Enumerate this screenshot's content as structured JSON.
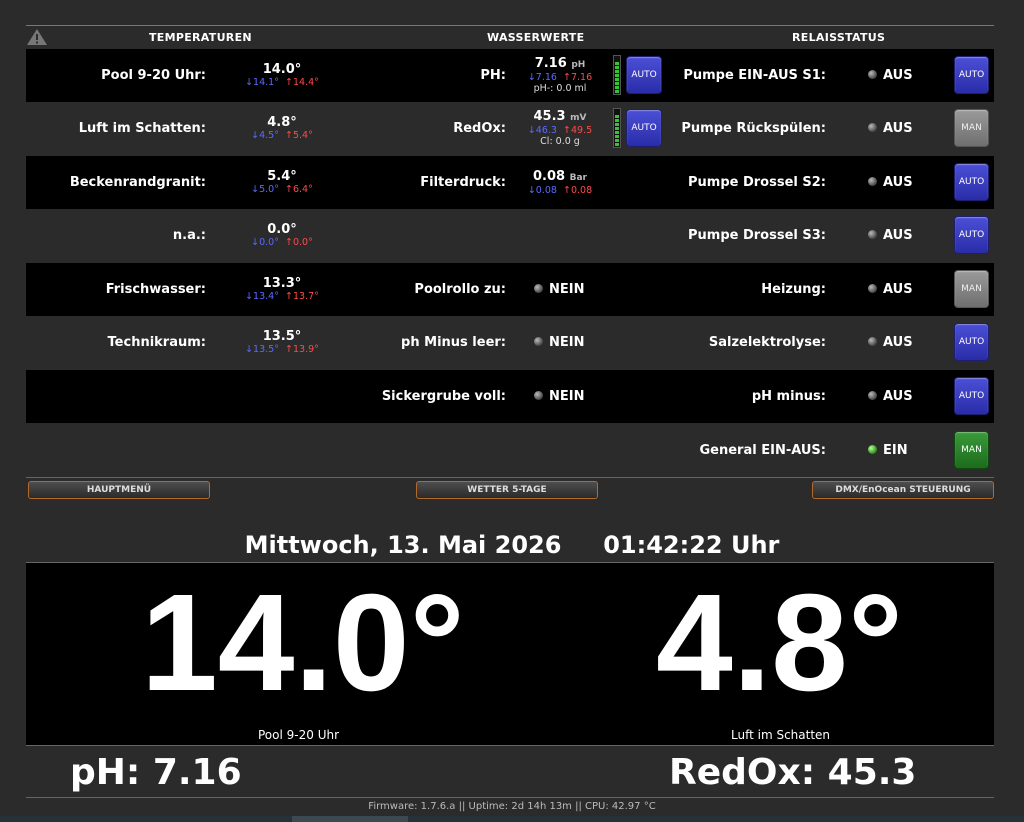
{
  "header": {
    "temperatures": "TEMPERATUREN",
    "water_values": "WASSERWERTE",
    "relay_status": "RELAISSTATUS"
  },
  "temperatures": [
    {
      "label": "Pool 9-20 Uhr:",
      "value": "14.0°",
      "min": "↓14.1°",
      "max": "↑14.4°"
    },
    {
      "label": "Luft im Schatten:",
      "value": "4.8°",
      "min": "↓4.5°",
      "max": "↑5.4°"
    },
    {
      "label": "Beckenrandgranit:",
      "value": "5.4°",
      "min": "↓5.0°",
      "max": "↑6.4°"
    },
    {
      "label": "n.a.:",
      "value": "0.0°",
      "min": "↓0.0°",
      "max": "↑0.0°"
    },
    {
      "label": "Frischwasser:",
      "value": "13.3°",
      "min": "↓13.4°",
      "max": "↑13.7°"
    },
    {
      "label": "Technikraum:",
      "value": "13.5°",
      "min": "↓13.5°",
      "max": "↑13.9°"
    }
  ],
  "water": {
    "ph": {
      "label": "PH:",
      "value": "7.16",
      "unit": "pH",
      "min": "↓7.16",
      "max": "↑7.16",
      "sub": "pH-: 0.0 ml",
      "mode": "AUTO"
    },
    "redox": {
      "label": "RedOx:",
      "value": "45.3",
      "unit": "mV",
      "min": "↓46.3",
      "max": "↑49.5",
      "sub": "Cl: 0.0 g",
      "mode": "AUTO"
    },
    "filter": {
      "label": "Filterdruck:",
      "value": "0.08",
      "unit": "Bar",
      "min": "↓0.08",
      "max": "↑0.08"
    },
    "poolrollo": {
      "label": "Poolrollo zu:",
      "state": "NEIN"
    },
    "ph_minus_empty": {
      "label": "ph Minus leer:",
      "state": "NEIN"
    },
    "sickergrube": {
      "label": "Sickergrube voll:",
      "state": "NEIN"
    }
  },
  "relays": [
    {
      "label": "Pumpe EIN-AUS S1:",
      "state": "AUS",
      "mode": "AUTO"
    },
    {
      "label": "Pumpe Rückspülen:",
      "state": "AUS",
      "mode": "MAN"
    },
    {
      "label": "Pumpe Drossel S2:",
      "state": "AUS",
      "mode": "AUTO"
    },
    {
      "label": "Pumpe Drossel S3:",
      "state": "AUS",
      "mode": "AUTO"
    },
    {
      "label": "Heizung:",
      "state": "AUS",
      "mode": "MAN"
    },
    {
      "label": "Salzelektrolyse:",
      "state": "AUS",
      "mode": "AUTO"
    },
    {
      "label": "pH minus:",
      "state": "AUS",
      "mode": "AUTO"
    },
    {
      "label": "General EIN-AUS:",
      "state": "EIN",
      "mode": "MAN"
    }
  ],
  "nav": {
    "main_menu": "HAUPTMENÜ",
    "weather": "WETTER 5-TAGE",
    "dmx": "DMX/EnOcean STEUERUNG"
  },
  "datetime": {
    "date": "Mittwoch, 13. Mai 2026",
    "time": "01:42:22 Uhr"
  },
  "big": {
    "left_value": "14.0°",
    "left_caption": "Pool 9-20 Uhr",
    "right_value": "4.8°",
    "right_caption": "Luft im Schatten"
  },
  "bottom": {
    "ph": "pH:  7.16",
    "redox": "RedOx:  45.3"
  },
  "footer": "Firmware: 1.7.6.a   ||   Uptime: 2d 14h 13m   ||   CPU: 42.97 °C"
}
